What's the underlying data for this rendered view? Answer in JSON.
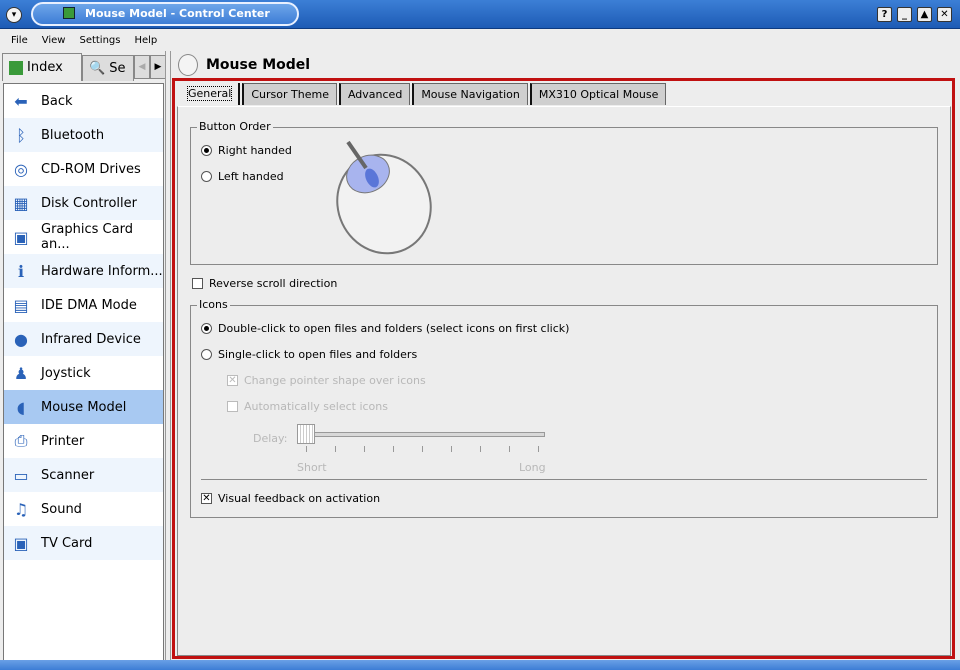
{
  "window": {
    "title": "Mouse Model - Control Center",
    "buttons": [
      "?",
      "_",
      "▲",
      "✕"
    ]
  },
  "menu": [
    "File",
    "View",
    "Settings",
    "Help"
  ],
  "left_tabs": {
    "index": "Index",
    "search": "Se"
  },
  "sidebar": {
    "items": [
      {
        "label": "Back",
        "icon": "back-arrow-icon"
      },
      {
        "label": "Bluetooth",
        "icon": "bluetooth-icon"
      },
      {
        "label": "CD-ROM Drives",
        "icon": "cdrom-icon"
      },
      {
        "label": "Disk Controller",
        "icon": "disk-controller-icon"
      },
      {
        "label": "Graphics Card an...",
        "icon": "graphics-card-icon"
      },
      {
        "label": "Hardware Inform...",
        "icon": "info-icon"
      },
      {
        "label": "IDE DMA Mode",
        "icon": "ide-icon"
      },
      {
        "label": "Infrared Device",
        "icon": "infrared-icon"
      },
      {
        "label": "Joystick",
        "icon": "joystick-icon"
      },
      {
        "label": "Mouse Model",
        "icon": "mouse-icon",
        "selected": true
      },
      {
        "label": "Printer",
        "icon": "printer-icon"
      },
      {
        "label": "Scanner",
        "icon": "scanner-icon"
      },
      {
        "label": "Sound",
        "icon": "sound-icon"
      },
      {
        "label": "TV Card",
        "icon": "tv-icon"
      }
    ]
  },
  "header": {
    "title": "Mouse Model"
  },
  "tabs": [
    "General",
    "Cursor Theme",
    "Advanced",
    "Mouse Navigation",
    "MX310 Optical Mouse"
  ],
  "general": {
    "button_order": {
      "label": "Button Order",
      "right": "Right handed",
      "left": "Left handed",
      "selected": "right"
    },
    "reverse_scroll": {
      "label": "Reverse scroll direction",
      "checked": false
    },
    "icons": {
      "label": "Icons",
      "double_click": "Double-click to open files and folders (select icons on first click)",
      "single_click": "Single-click to open files and folders",
      "change_pointer": "Change pointer shape over icons",
      "auto_select": "Automatically select icons",
      "delay_label": "Delay:",
      "short": "Short",
      "long": "Long",
      "delay_value": 0
    },
    "visual_feedback": {
      "label": "Visual feedback on activation",
      "checked": true
    }
  },
  "colors": {
    "accent": "#c01010",
    "selection": "#a8c9f2",
    "titlebar": "#2e6fc9"
  }
}
